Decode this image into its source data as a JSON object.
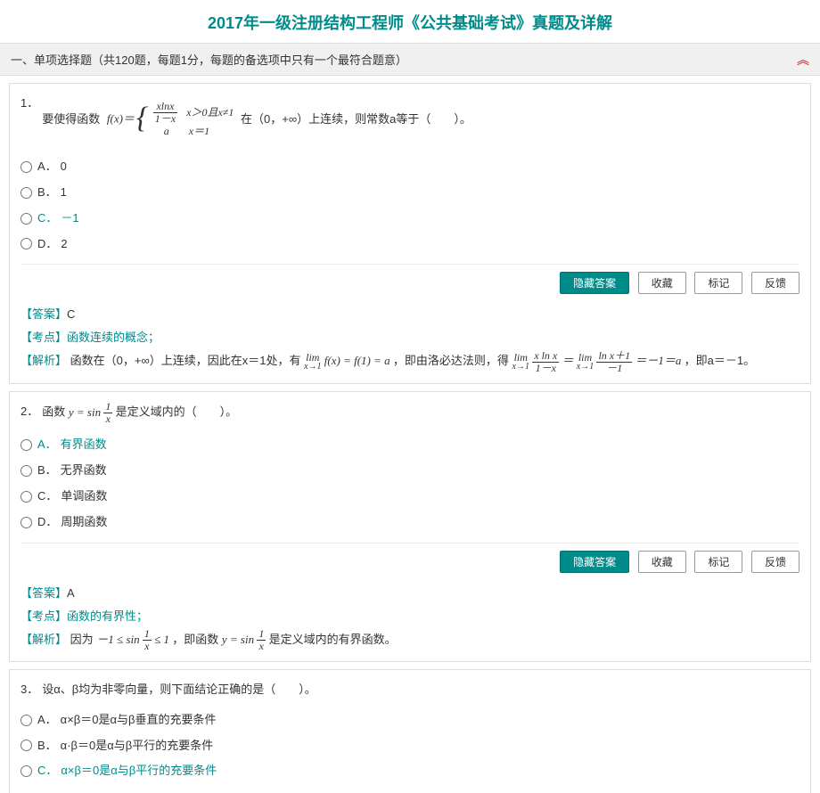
{
  "title": "2017年一级注册结构工程师《公共基础考试》真题及详解",
  "section": {
    "heading": "一、单项选择题（共120题，每题1分，每题的备选项中只有一个最符合题意）"
  },
  "buttons": {
    "hide_answer": "隐藏答案",
    "favorite": "收藏",
    "mark": "标记",
    "feedback": "反馈"
  },
  "tags": {
    "answer": "【答案】",
    "topic": "【考点】",
    "analysis": "【解析】"
  },
  "q1": {
    "num": "1．",
    "stem_before": "要使得函数",
    "fx_label": "f(x)＝",
    "piece1_cond": "x＞0且x≠1",
    "piece2_val": "a",
    "piece2_cond": "x＝1",
    "stem_after": "在（0，+∞）上连续，则常数a等于（　　）。",
    "optA_label": "A．",
    "optA": "0",
    "optB_label": "B．",
    "optB": "1",
    "optC_label": "C．",
    "optC": "－1",
    "optD_label": "D．",
    "optD": "2",
    "answer_val": "C",
    "topic_link": "函数连续的概念；",
    "analysis_text_1": "函数在（0，+∞）上连续，因此在x＝1处，有",
    "analysis_text_2": "，即由洛必达法则，得",
    "analysis_text_3": "，即a＝－1。"
  },
  "q2": {
    "num": "2．",
    "stem_before": "函数",
    "stem_after": "是定义域内的（　　）。",
    "optA_label": "A．",
    "optA": "有界函数",
    "optB_label": "B．",
    "optB": "无界函数",
    "optC_label": "C．",
    "optC": "单调函数",
    "optD_label": "D．",
    "optD": "周期函数",
    "answer_val": "A",
    "topic_link": "函数的有界性；",
    "analysis_text_1": "因为",
    "analysis_text_2": "，即函数",
    "analysis_text_3": "是定义域内的有界函数。"
  },
  "q3": {
    "num": "3．",
    "stem": "设α、β均为非零向量，则下面结论正确的是（　　）。",
    "optA_label": "A．",
    "optA": "α×β＝0是α与β垂直的充要条件",
    "optB_label": "B．",
    "optB": "α·β＝0是α与β平行的充要条件",
    "optC_label": "C．",
    "optC": "α×β＝0是α与β平行的充要条件"
  }
}
